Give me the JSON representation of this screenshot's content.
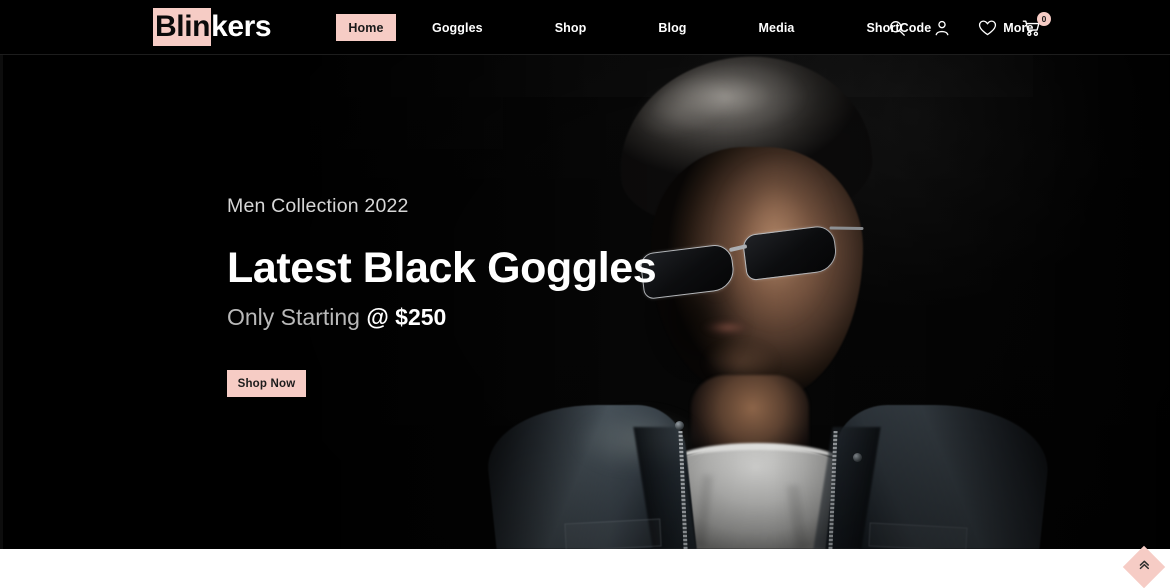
{
  "header": {
    "brand": {
      "highlight_text": "Blin",
      "rest_text": "kers",
      "highlight_bg": "#f6ccc5",
      "highlight_fg": "#0a0a0a",
      "rest_fg": "#ffffff"
    },
    "nav": [
      {
        "label": "Home",
        "active": true
      },
      {
        "label": "Goggles",
        "active": false
      },
      {
        "label": "Shop",
        "active": false
      },
      {
        "label": "Blog",
        "active": false
      },
      {
        "label": "Media",
        "active": false
      },
      {
        "label": "ShortCode",
        "active": false
      },
      {
        "label": "More",
        "active": false
      }
    ],
    "icons": [
      {
        "name": "search-icon"
      },
      {
        "name": "user-account-icon"
      },
      {
        "name": "wishlist-heart-icon"
      },
      {
        "name": "shopping-cart-icon"
      }
    ],
    "cart_count": "0",
    "background": "#000000"
  },
  "hero": {
    "eyebrow": "Men Collection 2022",
    "title": "Latest Black Goggles",
    "subtitle_light": "Only Starting",
    "subtitle_strong": "@ $250",
    "cta_label": "Shop Now",
    "cta_bg": "#f6ccc5",
    "cta_fg": "#1c1c1c",
    "background": "#000000",
    "image_alt": "Man wearing black sunglasses and a denim jacket in dark studio lighting"
  },
  "back_to_top": {
    "icon": "double-chevron-up-icon",
    "bg": "#f6ccc5"
  },
  "theme": {
    "accent": "#f6ccc5",
    "dark": "#000000",
    "text_light": "#ffffff",
    "text_muted": "#b9b9b9"
  }
}
